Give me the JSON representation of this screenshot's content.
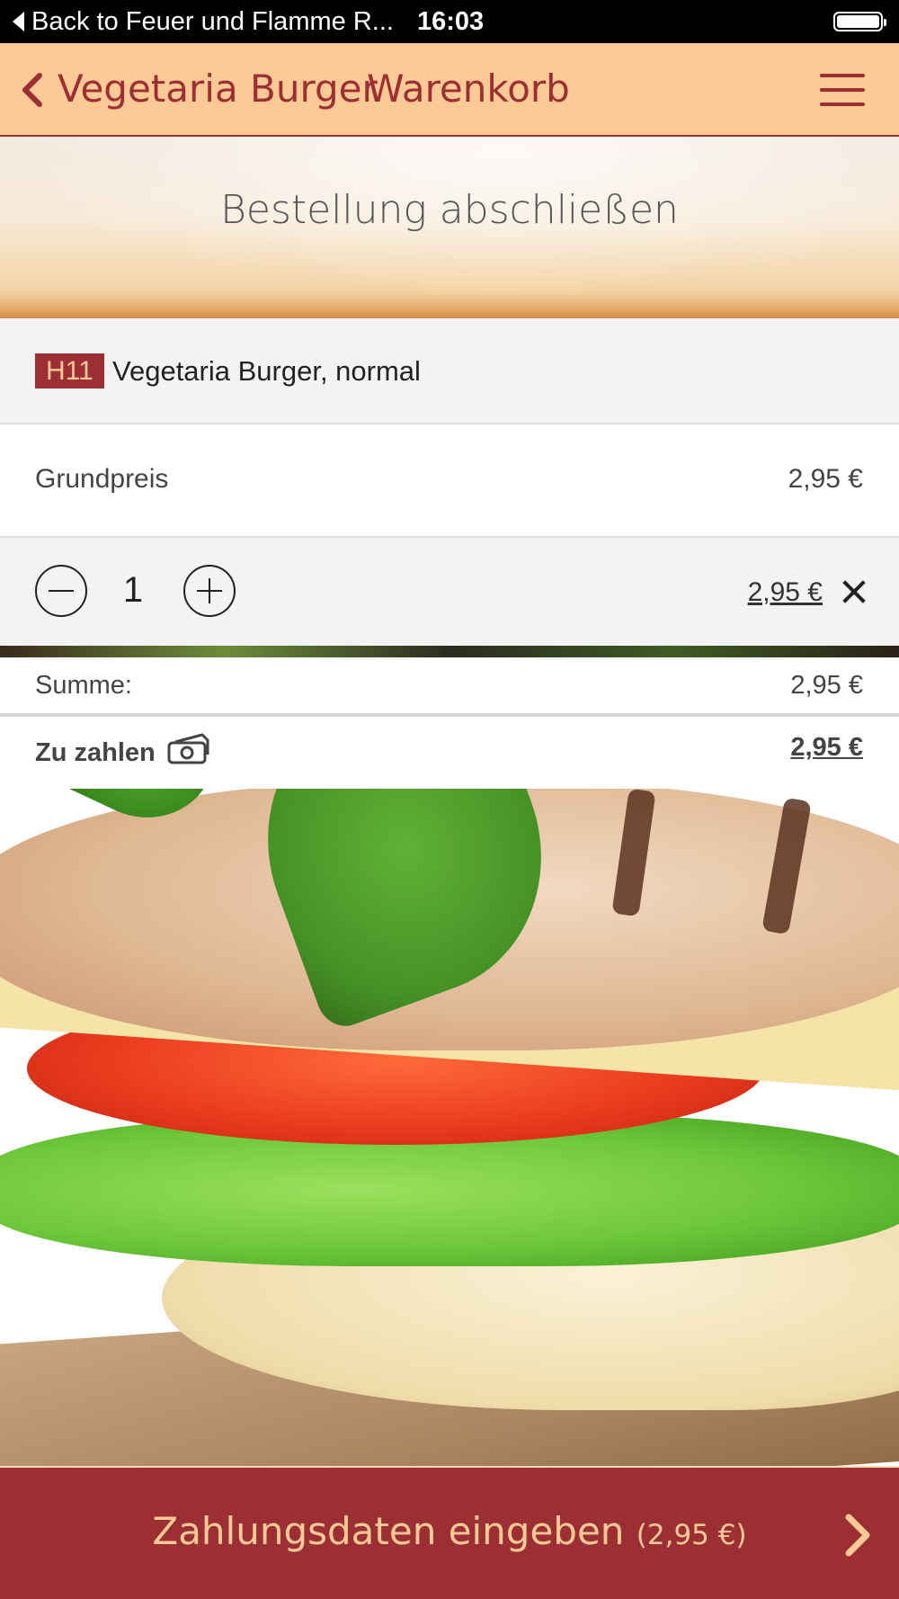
{
  "status_bar": {
    "back_label": "Back to Feuer und Flamme R...",
    "time": "16:03"
  },
  "nav": {
    "title": "Vegetaria Burger",
    "subtitle": "Warenkorb",
    "back_icon": "chevron-left-icon",
    "menu_icon": "hamburger-menu-icon"
  },
  "banner": {
    "heading": "Bestellung abschließen"
  },
  "item": {
    "code": "H11",
    "name": "Vegetaria Burger, normal"
  },
  "base_price": {
    "label": "Grundpreis",
    "value": "2,95 €"
  },
  "quantity": {
    "value": "1",
    "line_total": "2,95 €",
    "decrease_icon": "minus-circle-icon",
    "increase_icon": "plus-circle-icon",
    "remove_icon": "close-icon"
  },
  "summary": {
    "sum_label": "Summe:",
    "sum_value": "2,95 €",
    "pay_label": "Zu zahlen",
    "pay_value": "2,95 €",
    "pay_icon": "cash-icon"
  },
  "cta": {
    "label": "Zahlungsdaten eingeben",
    "amount": "(2,95 €)",
    "icon": "chevron-right-icon"
  },
  "colors": {
    "brand_red": "#9b2f33",
    "brand_peach": "#fdc995"
  }
}
